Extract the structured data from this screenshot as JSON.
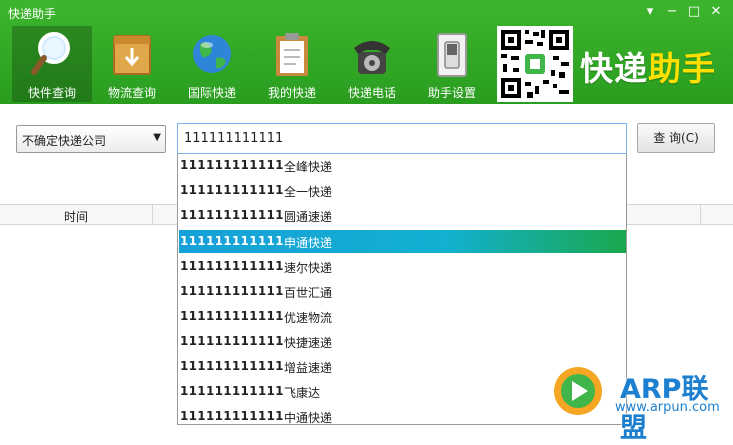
{
  "window": {
    "title": "快递助手",
    "controls": {
      "menu": "▾",
      "minimize": "−",
      "maximize": "□",
      "close": "✕"
    }
  },
  "toolbar": {
    "items": [
      {
        "label": "快件查询",
        "icon": "magnifier-icon",
        "active": true
      },
      {
        "label": "物流查询",
        "icon": "package-box-icon"
      },
      {
        "label": "国际快递",
        "icon": "globe-icon"
      },
      {
        "label": "我的快递",
        "icon": "clipboard-icon"
      },
      {
        "label": "快递电话",
        "icon": "telephone-icon"
      },
      {
        "label": "助手设置",
        "icon": "switch-icon"
      }
    ]
  },
  "brand": {
    "part1": "快递",
    "part2": "助手"
  },
  "search": {
    "company_select": "不确定快递公司",
    "tracking_number": "111111111111",
    "query_button": "查 询(C)"
  },
  "table": {
    "col_time": "时间"
  },
  "suggestions": [
    {
      "number": "111111111111",
      "company": "全峰快递"
    },
    {
      "number": "111111111111",
      "company": "全一快递"
    },
    {
      "number": "111111111111",
      "company": "圆通速递"
    },
    {
      "number": "111111111111",
      "company": "申通快递",
      "selected": true
    },
    {
      "number": "111111111111",
      "company": "速尔快递"
    },
    {
      "number": "111111111111",
      "company": "百世汇通"
    },
    {
      "number": "111111111111",
      "company": "优速物流"
    },
    {
      "number": "111111111111",
      "company": "快捷速递"
    },
    {
      "number": "111111111111",
      "company": "增益速递"
    },
    {
      "number": "111111111111",
      "company": "飞康达"
    },
    {
      "number": "111111111111",
      "company": "中通快递"
    }
  ],
  "watermark": {
    "text": "ARP联盟",
    "url": "www.arpun.com"
  },
  "colors": {
    "header_green": "#2a9d1f",
    "brand_yellow": "#ffe000",
    "selection_blue": "#16a0d8",
    "selection_green": "#1aa84e",
    "watermark_blue": "#1c7fd0"
  }
}
